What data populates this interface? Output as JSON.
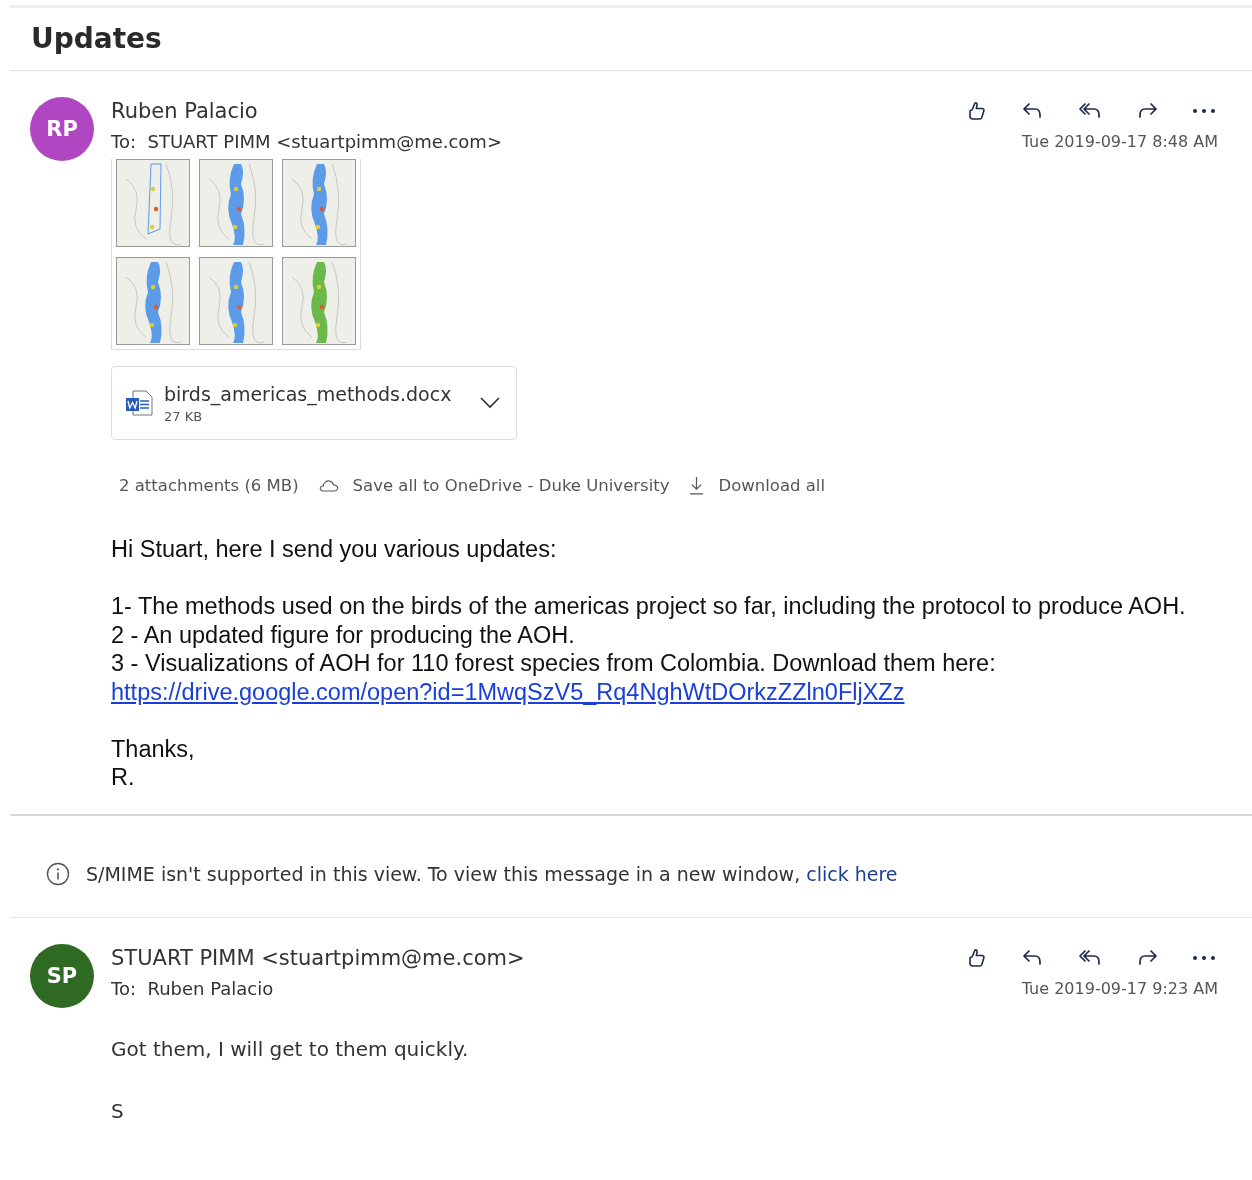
{
  "title": "Updates",
  "thread": [
    {
      "kind": "message",
      "initials": "RP",
      "color": "#b146c2",
      "sender": "Ruben Palacio",
      "to_label": "To:",
      "recipient": "STUART PIMM <stuartpimm@me.com>",
      "date": "Tue 2019-09-17 8:48 AM",
      "has_image_preview": true,
      "file": {
        "name": "birds_americas_methods.docx",
        "size": "27 KB"
      },
      "attachment_bar": {
        "summary": "2 attachments (6 MB)",
        "save": "Save all to OneDrive - Duke University",
        "download": "Download all"
      },
      "body": [
        {
          "kind": "text",
          "text": "Hi Stuart, here I send you various updates:"
        },
        {
          "kind": "gap"
        },
        {
          "kind": "text",
          "text": "1- The methods used on the birds of the americas project so far, including the protocol to produce AOH."
        },
        {
          "kind": "text",
          "text": "2 - An updated figure for producing the AOH."
        },
        {
          "kind": "text",
          "text": "3 - Visualizations of AOH for 110 forest species from Colombia. Download them here:"
        },
        {
          "kind": "link",
          "text": "https://drive.google.com/open?id=1MwqSzV5_Rq4NghWtDOrkzZZln0FljXZz"
        },
        {
          "kind": "gap"
        },
        {
          "kind": "text",
          "text": "Thanks,"
        },
        {
          "kind": "text",
          "text": "R."
        }
      ]
    },
    {
      "kind": "notice",
      "text": "S/MIME isn't supported in this view. To view this message in a new window,",
      "link": "click here"
    },
    {
      "kind": "message",
      "initials": "SP",
      "color": "#2f6a22",
      "sender": "STUART PIMM <stuartpimm@me.com>",
      "to_label": "To:",
      "recipient": "Ruben Palacio",
      "date": "Tue 2019-09-17 9:23 AM",
      "reply_body": [
        {
          "kind": "text",
          "text": "Got them,  I will get to them quickly."
        },
        {
          "kind": "gap"
        },
        {
          "kind": "text",
          "text": "S"
        }
      ]
    }
  ]
}
